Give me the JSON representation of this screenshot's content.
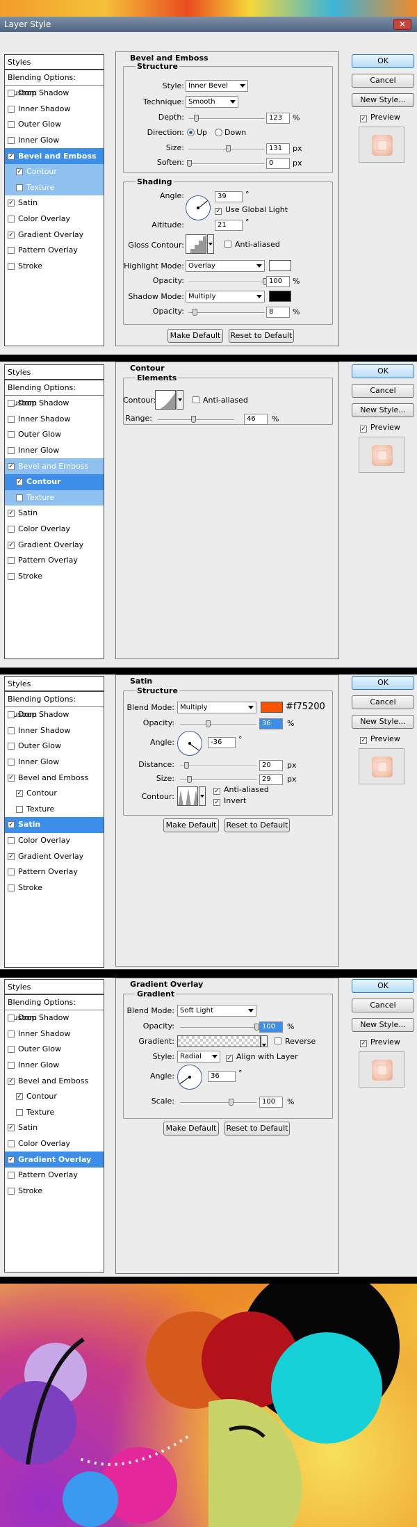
{
  "window": {
    "title": "Layer Style"
  },
  "buttons": {
    "ok": "OK",
    "cancel": "Cancel",
    "new_style": "New Style...",
    "preview": "Preview",
    "make_default": "Make Default",
    "reset_default": "Reset to Default"
  },
  "styles_list": {
    "header": "Styles",
    "blending": "Blending Options: Custom",
    "items": [
      "Drop Shadow",
      "Inner Shadow",
      "Outer Glow",
      "Inner Glow",
      "Bevel and Emboss",
      "Contour",
      "Texture",
      "Satin",
      "Color Overlay",
      "Gradient Overlay",
      "Pattern Overlay",
      "Stroke"
    ]
  },
  "bevel": {
    "title": "Bevel and Emboss",
    "structure": "Structure",
    "style_label": "Style:",
    "style_value": "Inner Bevel",
    "technique_label": "Technique:",
    "technique_value": "Smooth",
    "depth_label": "Depth:",
    "depth_value": "123",
    "depth_unit": "%",
    "direction_label": "Direction:",
    "dir_up": "Up",
    "dir_down": "Down",
    "size_label": "Size:",
    "size_value": "131",
    "size_unit": "px",
    "soften_label": "Soften:",
    "soften_value": "0",
    "soften_unit": "px",
    "shading": "Shading",
    "angle_label": "Angle:",
    "angle_value": "39",
    "deg": "°",
    "global_light": "Use Global Light",
    "altitude_label": "Altitude:",
    "altitude_value": "21",
    "gloss_label": "Gloss Contour:",
    "anti_aliased": "Anti-aliased",
    "highlight_label": "Highlight Mode:",
    "highlight_value": "Overlay",
    "opacity_label": "Opacity:",
    "hl_opacity": "100",
    "pct": "%",
    "shadow_label": "Shadow Mode:",
    "shadow_value": "Multiply",
    "sh_opacity": "8",
    "highlight_color": "#ffffff",
    "shadow_color": "#000000"
  },
  "contour": {
    "title": "Contour",
    "elements": "Elements",
    "contour_label": "Contour:",
    "anti_aliased": "Anti-aliased",
    "range_label": "Range:",
    "range_value": "46",
    "pct": "%"
  },
  "satin": {
    "title": "Satin",
    "structure": "Structure",
    "blend_label": "Blend Mode:",
    "blend_value": "Multiply",
    "color_hex": "#f75200",
    "opacity_label": "Opacity:",
    "opacity_value": "36",
    "pct": "%",
    "angle_label": "Angle:",
    "angle_value": "-36",
    "deg": "°",
    "distance_label": "Distance:",
    "distance_value": "20",
    "px": "px",
    "size_label": "Size:",
    "size_value": "29",
    "contour_label": "Contour:",
    "anti_aliased": "Anti-aliased",
    "invert": "Invert"
  },
  "gradient": {
    "title": "Gradient Overlay",
    "sub": "Gradient",
    "blend_label": "Blend Mode:",
    "blend_value": "Soft Light",
    "opacity_label": "Opacity:",
    "opacity_value": "100",
    "pct": "%",
    "gradient_label": "Gradient:",
    "reverse": "Reverse",
    "style_label": "Style:",
    "style_value": "Radial",
    "align": "Align with Layer",
    "angle_label": "Angle:",
    "angle_value": "36",
    "deg": "°",
    "scale_label": "Scale:",
    "scale_value": "100"
  }
}
